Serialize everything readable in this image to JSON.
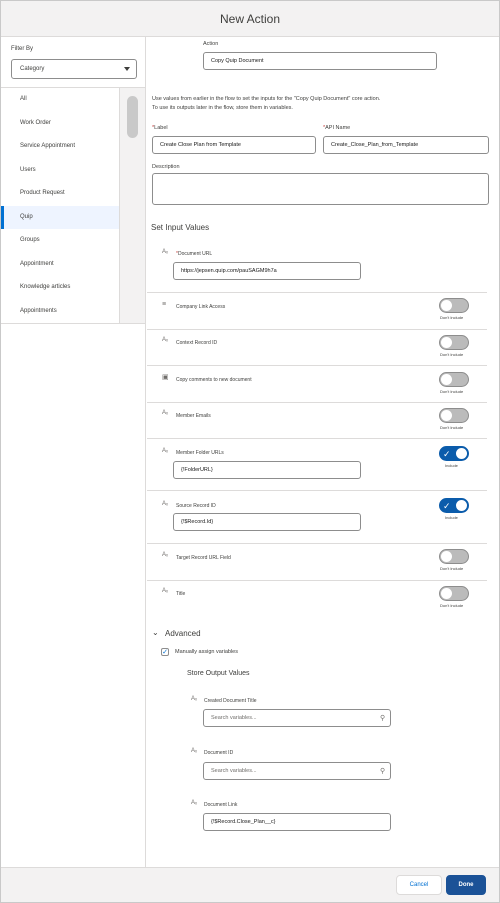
{
  "header": {
    "title": "New Action"
  },
  "filter": {
    "label": "Filter By",
    "value": "Category"
  },
  "categories": [
    {
      "label": "All"
    },
    {
      "label": "Work Order"
    },
    {
      "label": "Service Appointment"
    },
    {
      "label": "Users"
    },
    {
      "label": "Product Request"
    },
    {
      "label": "Quip"
    },
    {
      "label": "Groups"
    },
    {
      "label": "Appointment"
    },
    {
      "label": "Knowledge articles"
    },
    {
      "label": "Appointments"
    }
  ],
  "action": {
    "label": "Action",
    "value": "Copy Quip Document"
  },
  "help_text": {
    "line1": "Use values from earlier in the flow to set the inputs for the \"Copy Quip Document\" core action.",
    "line2": "To use its outputs later in the flow, store them in variables."
  },
  "label_field": {
    "label": "Label",
    "value": "Create Close Plan from Template"
  },
  "api_name": {
    "label": "API Name",
    "value": "Create_Close_Plan_from_Template"
  },
  "description": {
    "label": "Description",
    "value": ""
  },
  "set_input": {
    "title": "Set Input Values",
    "type_icon": "Aₓ",
    "params": [
      {
        "name": "Document URL",
        "required": true,
        "value": "https://jepsen.quip.com/pauSAGM9h7a"
      },
      {
        "name": "Company Link Access",
        "state": "Don't Include"
      },
      {
        "name": "Context Record ID",
        "state": "Don't Include"
      },
      {
        "name": "Copy comments to new document",
        "state": "Don't Include"
      },
      {
        "name": "Member Emails",
        "state": "Don't Include"
      },
      {
        "name": "Member Folder URLs",
        "state": "Include",
        "value": "{!FolderURL}"
      },
      {
        "name": "Source Record ID",
        "state": "Include",
        "value": "{!$Record.Id}"
      },
      {
        "name": "Target Record URL Field",
        "state": "Don't Include"
      },
      {
        "name": "Title",
        "state": "Don't Include"
      }
    ]
  },
  "advanced": {
    "title": "Advanced",
    "manual_label": "Manually assign variables",
    "store_title": "Store Output Values",
    "outputs": [
      {
        "name": "Created Document Title",
        "placeholder": "Search variables..."
      },
      {
        "name": "Document ID",
        "placeholder": "Search variables..."
      },
      {
        "name": "Document Link",
        "value": "{!$Record.Close_Plan__c}"
      }
    ]
  },
  "footer": {
    "cancel": "Cancel",
    "done": "Done"
  },
  "colors": {
    "brand": "#1b5297",
    "accent": "#0070d2",
    "toggle_on": "#0b5cab"
  }
}
